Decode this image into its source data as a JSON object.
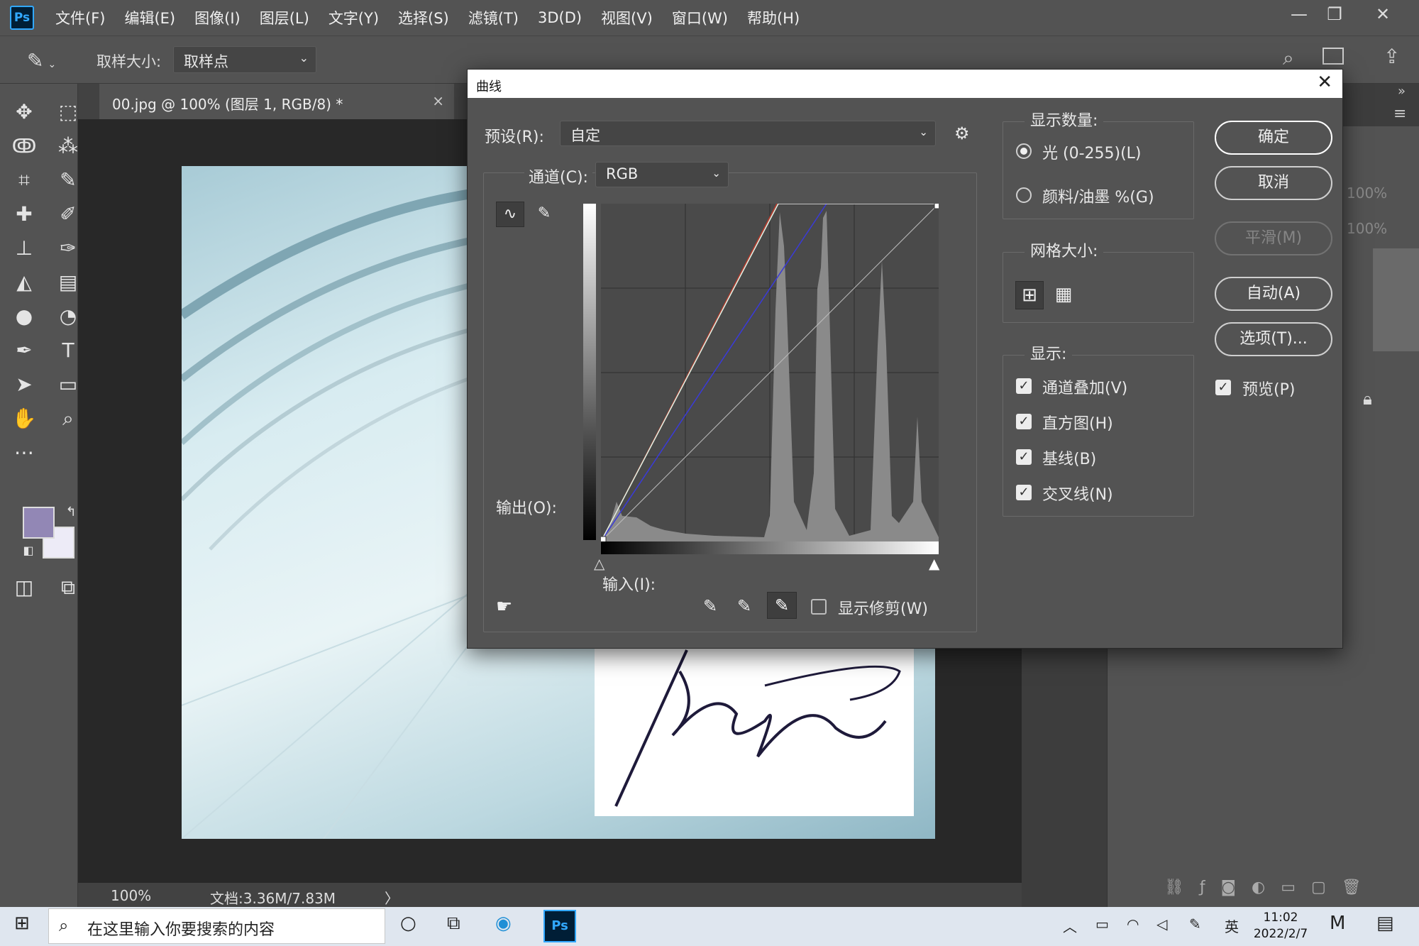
{
  "app": {
    "logo": "Ps",
    "menu": [
      "文件(F)",
      "编辑(E)",
      "图像(I)",
      "图层(L)",
      "文字(Y)",
      "选择(S)",
      "滤镜(T)",
      "3D(D)",
      "视图(V)",
      "窗口(W)",
      "帮助(H)"
    ],
    "window_controls": [
      "—",
      "❐",
      "✕"
    ]
  },
  "options_bar": {
    "sample_size_label": "取样大小:",
    "sample_size_value": "取样点"
  },
  "document": {
    "tab_title": "00.jpg @ 100% (图层 1, RGB/8) *",
    "tab_close": "×",
    "zoom": "100%",
    "doc_size": "文档:3.36M/7.83M",
    "status_arrow": "〉"
  },
  "right_panel": {
    "opacity_1": "100%",
    "opacity_2": "100%"
  },
  "curves_dialog": {
    "title": "曲线",
    "close": "✕",
    "preset_label": "预设(R):",
    "preset_value": "自定",
    "channel_label": "通道(C):",
    "channel_value": "RGB",
    "output_label": "输出(O):",
    "input_label": "输入(I):",
    "show_clipping_label": "显示修剪(W)",
    "show_clipping_checked": false,
    "display_amount": {
      "title": "显示数量:",
      "options": [
        "光 (0-255)(L)",
        "颜料/油墨 %(G)"
      ],
      "selected_index": 0
    },
    "grid_size": {
      "title": "网格大小:"
    },
    "display": {
      "title": "显示:",
      "options": [
        {
          "label": "通道叠加(V)",
          "checked": true
        },
        {
          "label": "直方图(H)",
          "checked": true
        },
        {
          "label": "基线(B)",
          "checked": true
        },
        {
          "label": "交叉线(N)",
          "checked": true
        }
      ]
    },
    "buttons": {
      "ok": "确定",
      "cancel": "取消",
      "smooth": "平滑(M)",
      "auto": "自动(A)",
      "options": "选项(T)..."
    },
    "preview_label": "预览(P)",
    "preview_checked": true,
    "curve_colors": {
      "rgb": "#e8e8e8",
      "red": "#c0392b",
      "green": "#2ecc40",
      "blue": "#3a3ad8"
    }
  },
  "taskbar": {
    "search_placeholder": "在这里输入你要搜索的内容",
    "ps_label": "Ps",
    "ime": "英",
    "time": "11:02",
    "date": "2022/2/7"
  }
}
